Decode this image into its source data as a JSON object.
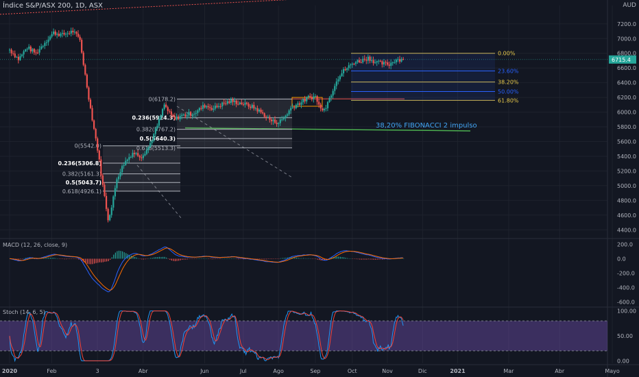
{
  "header": {
    "title": "Índice S&P/ASX 200, 1D, ASX",
    "currency": "AUD"
  },
  "price_axis": {
    "ticks": [
      "7200.0",
      "7000.0",
      "6800.0",
      "6600.0",
      "6400.0",
      "6200.0",
      "6000.0",
      "5800.0",
      "5600.0",
      "5400.0",
      "5200.0",
      "5000.0",
      "4800.0",
      "4600.0",
      "4400.0"
    ],
    "tick_values": [
      7200,
      7000,
      6800,
      6600,
      6400,
      6200,
      6000,
      5800,
      5600,
      5400,
      5200,
      5000,
      4800,
      4600,
      4400
    ],
    "last_price": "6715.4",
    "range": [
      4300,
      7450
    ]
  },
  "time_axis": {
    "labels": [
      "2020",
      "Feb",
      "3",
      "Abr",
      "Jun",
      "Jul",
      "Ago",
      "Sep",
      "Oct",
      "Nov",
      "Dic",
      "2021",
      "Mar",
      "Abr",
      "Mayo"
    ],
    "label_days": [
      0,
      48,
      100,
      152,
      222,
      266,
      306,
      348,
      390,
      430,
      470,
      510,
      568,
      626,
      686
    ]
  },
  "colors": {
    "up": "#26a69a",
    "down": "#ef5350",
    "background": "#131722",
    "grid": "#1e222d",
    "macd": "#2962ff",
    "signal": "#ff6d00",
    "stoch_k": "#2196f3",
    "stoch_d": "#f44336",
    "stoch_band": "#7e57c2"
  },
  "chart_data": {
    "type": "candlestick",
    "series_key_points": [
      [
        0,
        6850
      ],
      [
        10,
        6720
      ],
      [
        20,
        6880
      ],
      [
        30,
        6800
      ],
      [
        40,
        6950
      ],
      [
        50,
        7080
      ],
      [
        60,
        7050
      ],
      [
        72,
        7100
      ],
      [
        80,
        6980
      ],
      [
        86,
        6500
      ],
      [
        92,
        6050
      ],
      [
        100,
        5500
      ],
      [
        106,
        5000
      ],
      [
        112,
        4550
      ],
      [
        116,
        4700
      ],
      [
        122,
        5100
      ],
      [
        130,
        5300
      ],
      [
        140,
        5450
      ],
      [
        150,
        5400
      ],
      [
        158,
        5520
      ],
      [
        166,
        5750
      ],
      [
        172,
        5950
      ],
      [
        176,
        6100
      ],
      [
        182,
        5980
      ],
      [
        188,
        5900
      ],
      [
        194,
        5950
      ],
      [
        200,
        5960
      ],
      [
        212,
        6000
      ],
      [
        222,
        6090
      ],
      [
        232,
        6050
      ],
      [
        240,
        6100
      ],
      [
        252,
        6150
      ],
      [
        264,
        6120
      ],
      [
        274,
        6080
      ],
      [
        280,
        6050
      ],
      [
        290,
        5960
      ],
      [
        298,
        5880
      ],
      [
        306,
        5860
      ],
      [
        312,
        5920
      ],
      [
        320,
        6050
      ],
      [
        326,
        6100
      ],
      [
        334,
        6150
      ],
      [
        340,
        6200
      ],
      [
        348,
        6210
      ],
      [
        354,
        6040
      ],
      [
        360,
        6080
      ],
      [
        366,
        6250
      ],
      [
        372,
        6440
      ],
      [
        380,
        6560
      ],
      [
        386,
        6620
      ],
      [
        392,
        6680
      ],
      [
        400,
        6700
      ],
      [
        408,
        6740
      ],
      [
        416,
        6680
      ],
      [
        424,
        6660
      ],
      [
        432,
        6650
      ],
      [
        440,
        6720
      ],
      [
        448,
        6715
      ]
    ],
    "fibonacci_sets": [
      {
        "levels": [
          {
            "label": "0(5542.0)",
            "value": 5542.0
          },
          {
            "label": "0.236(5306.8)",
            "value": 5306.8
          },
          {
            "label": "0.382(5161.3)",
            "value": 5161.3
          },
          {
            "label": "0.5(5043.7)",
            "value": 5043.7
          },
          {
            "label": "0.618(4926.1)",
            "value": 4926.1
          }
        ]
      },
      {
        "levels": [
          {
            "label": "0(6178.2)",
            "value": 6178.2
          },
          {
            "label": "0.236(5924.3)",
            "value": 5924.3
          },
          {
            "label": "0.382(5767.2)",
            "value": 5767.2
          },
          {
            "label": "0.5(5640.3)",
            "value": 5640.3
          },
          {
            "label": "0.618(5513.3)",
            "value": 5513.3
          }
        ]
      },
      {
        "levels": [
          {
            "label": "0.00%",
            "value": 6800
          },
          {
            "label": "23.60%",
            "value": 6560
          },
          {
            "label": "38.20%",
            "value": 6410
          },
          {
            "label": "50.00%",
            "value": 6280
          },
          {
            "label": "61.80%",
            "value": 6160
          }
        ]
      }
    ],
    "annotation": "38,20% FIBONACCI 2 impulso",
    "macd": {
      "label": "MACD (12, 26, close, 9)",
      "ticks": [
        "200.0",
        "0.0",
        "-200.0",
        "-400.0",
        "-600.0"
      ],
      "tick_values": [
        200,
        0,
        -200,
        -400,
        -600
      ],
      "range": [
        -650,
        260
      ]
    },
    "stoch": {
      "label": "Stoch (14, 6, 5)",
      "ticks": [
        "100.00",
        "50.00",
        "0.00"
      ],
      "tick_values": [
        100,
        50,
        0
      ],
      "range": [
        -5,
        105
      ],
      "band": [
        20,
        80
      ]
    }
  }
}
